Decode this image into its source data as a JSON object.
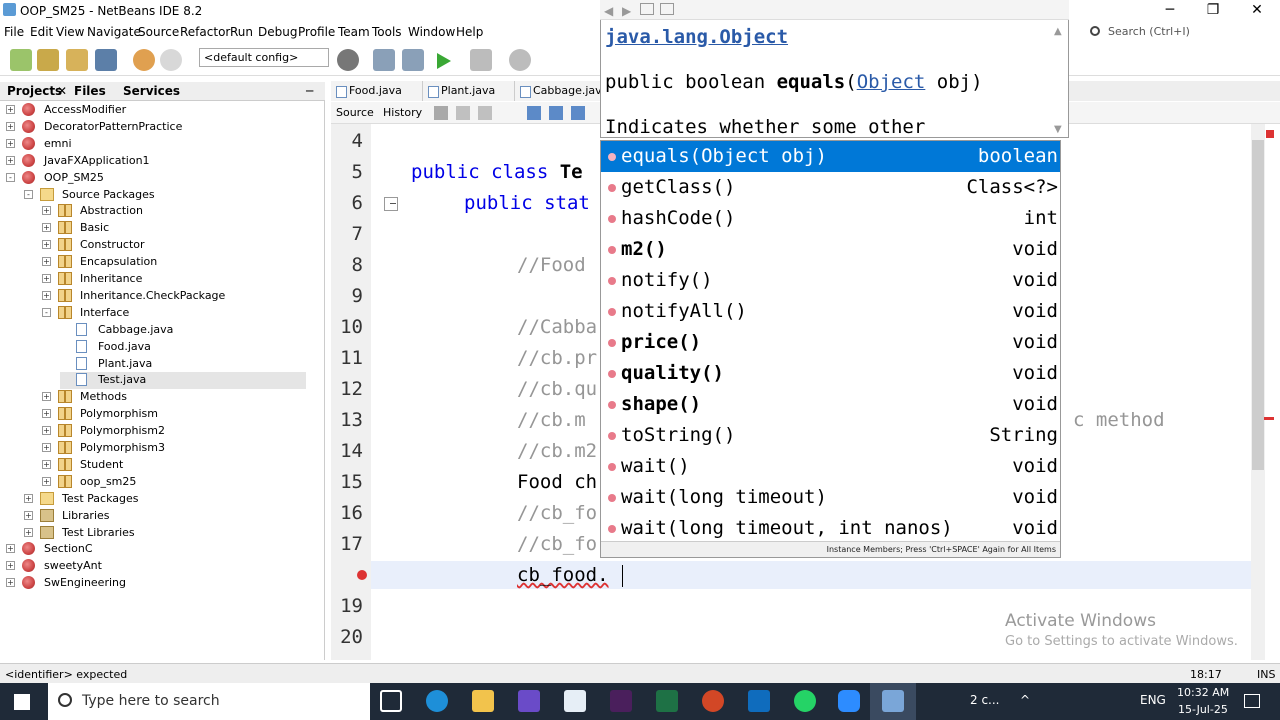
{
  "window": {
    "title": "OOP_SM25 - NetBeans IDE 8.2",
    "minimize": "─",
    "maximize": "❐",
    "close": "✕"
  },
  "menu": [
    "File",
    "Edit",
    "View",
    "Navigate",
    "Source",
    "Refactor",
    "Run",
    "Debug",
    "Profile",
    "Team",
    "Tools",
    "Window",
    "Help"
  ],
  "toolbar": {
    "config": "<default config>"
  },
  "search": {
    "placeholder": "Search (Ctrl+I)"
  },
  "panel_tabs": {
    "projects": "Projects",
    "files": "Files",
    "services": "Services",
    "close": "✕",
    "minimize": "─"
  },
  "tree": [
    {
      "label": "AccessModifier",
      "type": "proj",
      "depth": 0,
      "toggle": "+"
    },
    {
      "label": "DecoratorPatternPractice",
      "type": "proj",
      "depth": 0,
      "toggle": "+"
    },
    {
      "label": "emni",
      "type": "proj",
      "depth": 0,
      "toggle": "+"
    },
    {
      "label": "JavaFXApplication1",
      "type": "proj",
      "depth": 0,
      "toggle": "+"
    },
    {
      "label": "OOP_SM25",
      "type": "proj",
      "depth": 0,
      "toggle": "-"
    },
    {
      "label": "Source Packages",
      "type": "src",
      "depth": 1,
      "toggle": "-"
    },
    {
      "label": "Abstraction",
      "type": "pkg",
      "depth": 2,
      "toggle": "+"
    },
    {
      "label": "Basic",
      "type": "pkg",
      "depth": 2,
      "toggle": "+"
    },
    {
      "label": "Constructor",
      "type": "pkg",
      "depth": 2,
      "toggle": "+"
    },
    {
      "label": "Encapsulation",
      "type": "pkg",
      "depth": 2,
      "toggle": "+"
    },
    {
      "label": "Inheritance",
      "type": "pkg",
      "depth": 2,
      "toggle": "+"
    },
    {
      "label": "Inheritance.CheckPackage",
      "type": "pkg",
      "depth": 2,
      "toggle": "+"
    },
    {
      "label": "Interface",
      "type": "pkg",
      "depth": 2,
      "toggle": "-"
    },
    {
      "label": "Cabbage.java",
      "type": "file",
      "depth": 3,
      "toggle": ""
    },
    {
      "label": "Food.java",
      "type": "file",
      "depth": 3,
      "toggle": ""
    },
    {
      "label": "Plant.java",
      "type": "file",
      "depth": 3,
      "toggle": ""
    },
    {
      "label": "Test.java",
      "type": "file",
      "depth": 3,
      "toggle": "",
      "selected": true
    },
    {
      "label": "Methods",
      "type": "pkg",
      "depth": 2,
      "toggle": "+"
    },
    {
      "label": "Polymorphism",
      "type": "pkg",
      "depth": 2,
      "toggle": "+"
    },
    {
      "label": "Polymorphism2",
      "type": "pkg",
      "depth": 2,
      "toggle": "+"
    },
    {
      "label": "Polymorphism3",
      "type": "pkg",
      "depth": 2,
      "toggle": "+"
    },
    {
      "label": "Student",
      "type": "pkg",
      "depth": 2,
      "toggle": "+"
    },
    {
      "label": "oop_sm25",
      "type": "pkg",
      "depth": 2,
      "toggle": "+"
    },
    {
      "label": "Test Packages",
      "type": "src",
      "depth": 1,
      "toggle": "+"
    },
    {
      "label": "Libraries",
      "type": "lib",
      "depth": 1,
      "toggle": "+"
    },
    {
      "label": "Test Libraries",
      "type": "lib",
      "depth": 1,
      "toggle": "+"
    },
    {
      "label": "SectionC",
      "type": "proj",
      "depth": 0,
      "toggle": "+"
    },
    {
      "label": "sweetyAnt",
      "type": "proj",
      "depth": 0,
      "toggle": "+"
    },
    {
      "label": "SwEngineering",
      "type": "proj",
      "depth": 0,
      "toggle": "+"
    }
  ],
  "editor_tabs": [
    "Food.java",
    "Plant.java",
    "Cabbage.java"
  ],
  "editor_toolbar": {
    "source": "Source",
    "history": "History"
  },
  "code": {
    "lines": [
      "4",
      "5",
      "6",
      "7",
      "8",
      "9",
      "10",
      "11",
      "12",
      "13",
      "14",
      "15",
      "16",
      "17",
      "18",
      "19",
      "20"
    ],
    "l5_kw": "public class",
    "l5_rest": " Te",
    "l6_kw": "public stat",
    "l8": "//Food",
    "l10": "//Cabba",
    "l11": "//cb.pr",
    "l12": "//cb.qu",
    "l13": "//cb.m",
    "l13_tail": "c method",
    "l14": "//cb.m2",
    "l15": "Food ch",
    "l16": "//cb_fo",
    "l17": "//cb_fo",
    "l18": "cb_food."
  },
  "javadoc": {
    "class": "java.lang.Object",
    "sig_pre": "public boolean ",
    "sig_name": "equals",
    "sig_paren": "(",
    "sig_type": "Object",
    "sig_post": " obj)",
    "desc": "Indicates whether some other"
  },
  "completion": [
    {
      "name": "equals(Object obj)",
      "type": "boolean",
      "bold": false,
      "selected": true
    },
    {
      "name": "getClass()",
      "type": "Class<?>",
      "bold": false
    },
    {
      "name": "hashCode()",
      "type": "int",
      "bold": false
    },
    {
      "name": "m2()",
      "type": "void",
      "bold": true
    },
    {
      "name": "notify()",
      "type": "void",
      "bold": false
    },
    {
      "name": "notifyAll()",
      "type": "void",
      "bold": false
    },
    {
      "name": "price()",
      "type": "void",
      "bold": true
    },
    {
      "name": "quality()",
      "type": "void",
      "bold": true
    },
    {
      "name": "shape()",
      "type": "void",
      "bold": true
    },
    {
      "name": "toString()",
      "type": "String",
      "bold": false
    },
    {
      "name": "wait()",
      "type": "void",
      "bold": false
    },
    {
      "name": "wait(long timeout)",
      "type": "void",
      "bold": false
    },
    {
      "name": "wait(long timeout, int nanos)",
      "type": "void",
      "bold": false
    }
  ],
  "completion_footer": "Instance Members; Press 'Ctrl+SPACE' Again for All Items",
  "watermark": {
    "line1": "Activate Windows",
    "line2": "Go to Settings to activate Windows."
  },
  "status": {
    "message": "<identifier> expected",
    "position": "18:17",
    "mode": "INS"
  },
  "taskbar": {
    "search_placeholder": "Type here to search",
    "weather": "2 c...",
    "lang": "ENG",
    "time": "10:32 AM",
    "date": "15-Jul-25"
  },
  "colors": {
    "selection": "#0078d7",
    "keyword": "#0000e6",
    "comment": "#969696"
  }
}
